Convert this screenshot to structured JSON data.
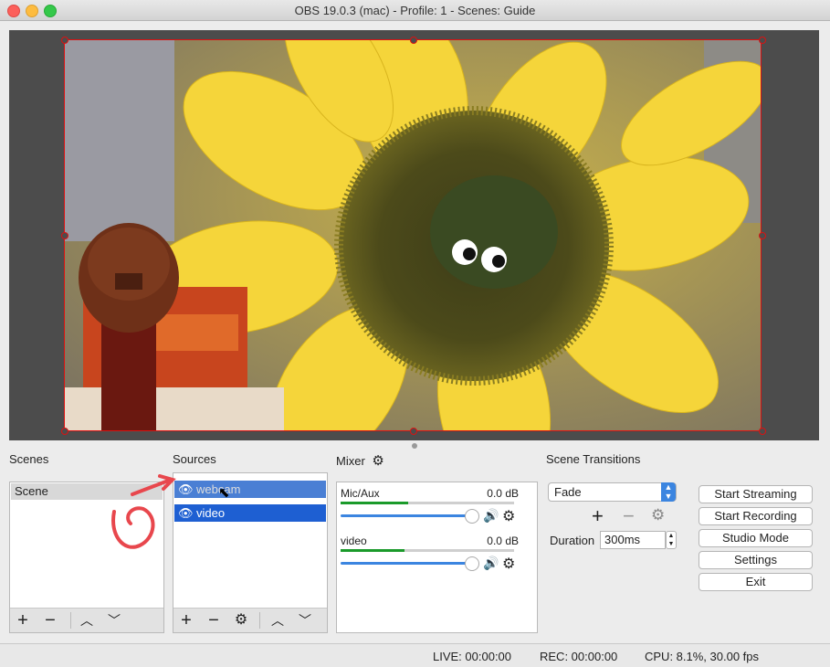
{
  "window": {
    "title": "OBS 19.0.3 (mac) - Profile: 1 - Scenes: Guide"
  },
  "scenes": {
    "label": "Scenes",
    "items": [
      "Scene"
    ]
  },
  "sources": {
    "label": "Sources",
    "items": [
      {
        "name": "webcam",
        "visible": true
      },
      {
        "name": "video",
        "visible": true
      }
    ]
  },
  "mixer": {
    "label": "Mixer",
    "channels": [
      {
        "name": "Mic/Aux",
        "level": "0.0 dB"
      },
      {
        "name": "video",
        "level": "0.0 dB"
      }
    ]
  },
  "transitions": {
    "label": "Scene Transitions",
    "selected": "Fade",
    "duration_label": "Duration",
    "duration_value": "300ms"
  },
  "controls": {
    "start_streaming": "Start Streaming",
    "start_recording": "Start Recording",
    "studio_mode": "Studio Mode",
    "settings": "Settings",
    "exit": "Exit"
  },
  "status": {
    "live": "LIVE: 00:00:00",
    "rec": "REC: 00:00:00",
    "cpu": "CPU: 8.1%, 30.00 fps"
  }
}
